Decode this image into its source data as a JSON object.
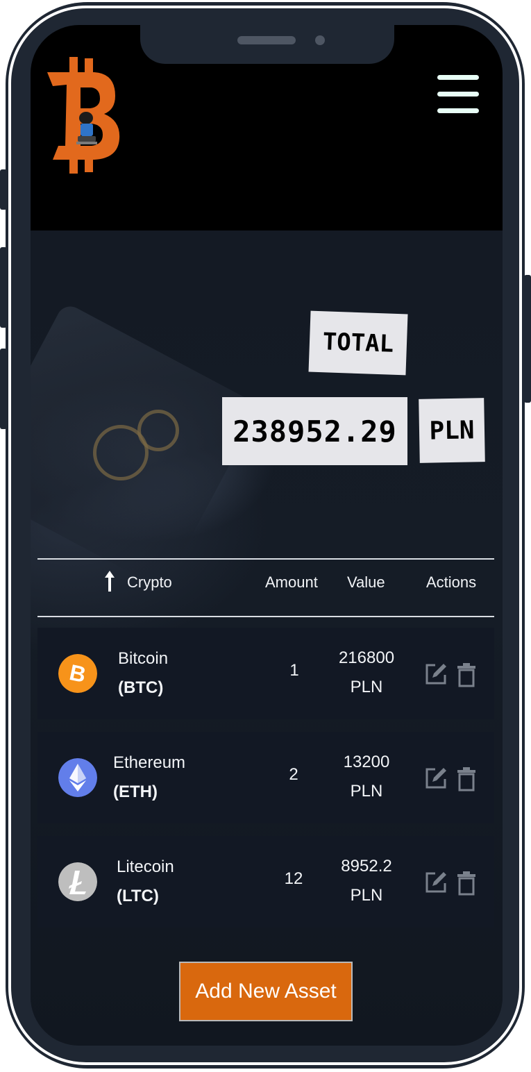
{
  "header": {
    "logo_icon": "bitcoin-logo-icon",
    "menu_icon": "hamburger-menu-icon"
  },
  "summary": {
    "total_label": "TOTAL",
    "total_value": "238952.29",
    "currency": "PLN"
  },
  "table": {
    "sort_icon": "sort-up-arrow-icon",
    "headers": {
      "crypto": "Crypto",
      "amount": "Amount",
      "value": "Value",
      "actions": "Actions"
    },
    "rows": [
      {
        "name": "Bitcoin",
        "symbol": "(BTC)",
        "amount": "1",
        "value": "216800",
        "currency": "PLN",
        "icon": "bitcoin-icon",
        "color": "#f7931a"
      },
      {
        "name": "Ethereum",
        "symbol": "(ETH)",
        "amount": "2",
        "value": "13200",
        "currency": "PLN",
        "icon": "ethereum-icon",
        "color": "#627eea"
      },
      {
        "name": "Litecoin",
        "symbol": "(LTC)",
        "amount": "12",
        "value": "8952.2",
        "currency": "PLN",
        "icon": "litecoin-icon",
        "color": "#bebebe"
      }
    ]
  },
  "add_button": {
    "label": "Add New Asset",
    "color": "#d9680e"
  }
}
